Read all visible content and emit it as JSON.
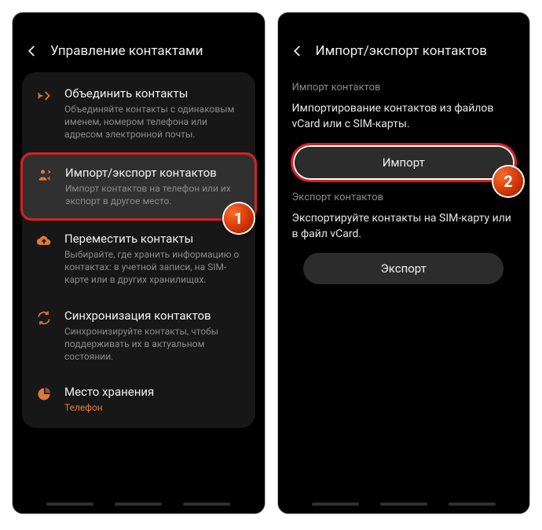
{
  "left": {
    "header": "Управление контактами",
    "items": [
      {
        "title": "Объединить контакты",
        "desc": "Объединяйте контакты с одинаковым именем, номером телефона или адресом электронной почты."
      },
      {
        "title": "Импорт/экспорт контактов",
        "desc": "Импорт контактов на телефон или их экспорт в другое место."
      },
      {
        "title": "Переместить контакты",
        "desc": "Выбирайте, где хранить информацию о контактах: в учетной записи, на SIM-карте или в других хранилищах."
      },
      {
        "title": "Синхронизация контактов",
        "desc": "Синхронизируйте контакты, чтобы поддерживать их в актуальном состоянии."
      },
      {
        "title": "Место хранения",
        "value": "Телефон"
      }
    ]
  },
  "right": {
    "header": "Импорт/экспорт контактов",
    "import_section": "Импорт контактов",
    "import_desc": "Импортирование контактов из файлов vCard или с SIM-карты.",
    "import_btn": "Импорт",
    "export_section": "Экспорт контактов",
    "export_desc": "Экспортируйте контакты на SIM-карту или в файл vCard.",
    "export_btn": "Экспорт"
  },
  "markers": {
    "one": "1",
    "two": "2"
  }
}
